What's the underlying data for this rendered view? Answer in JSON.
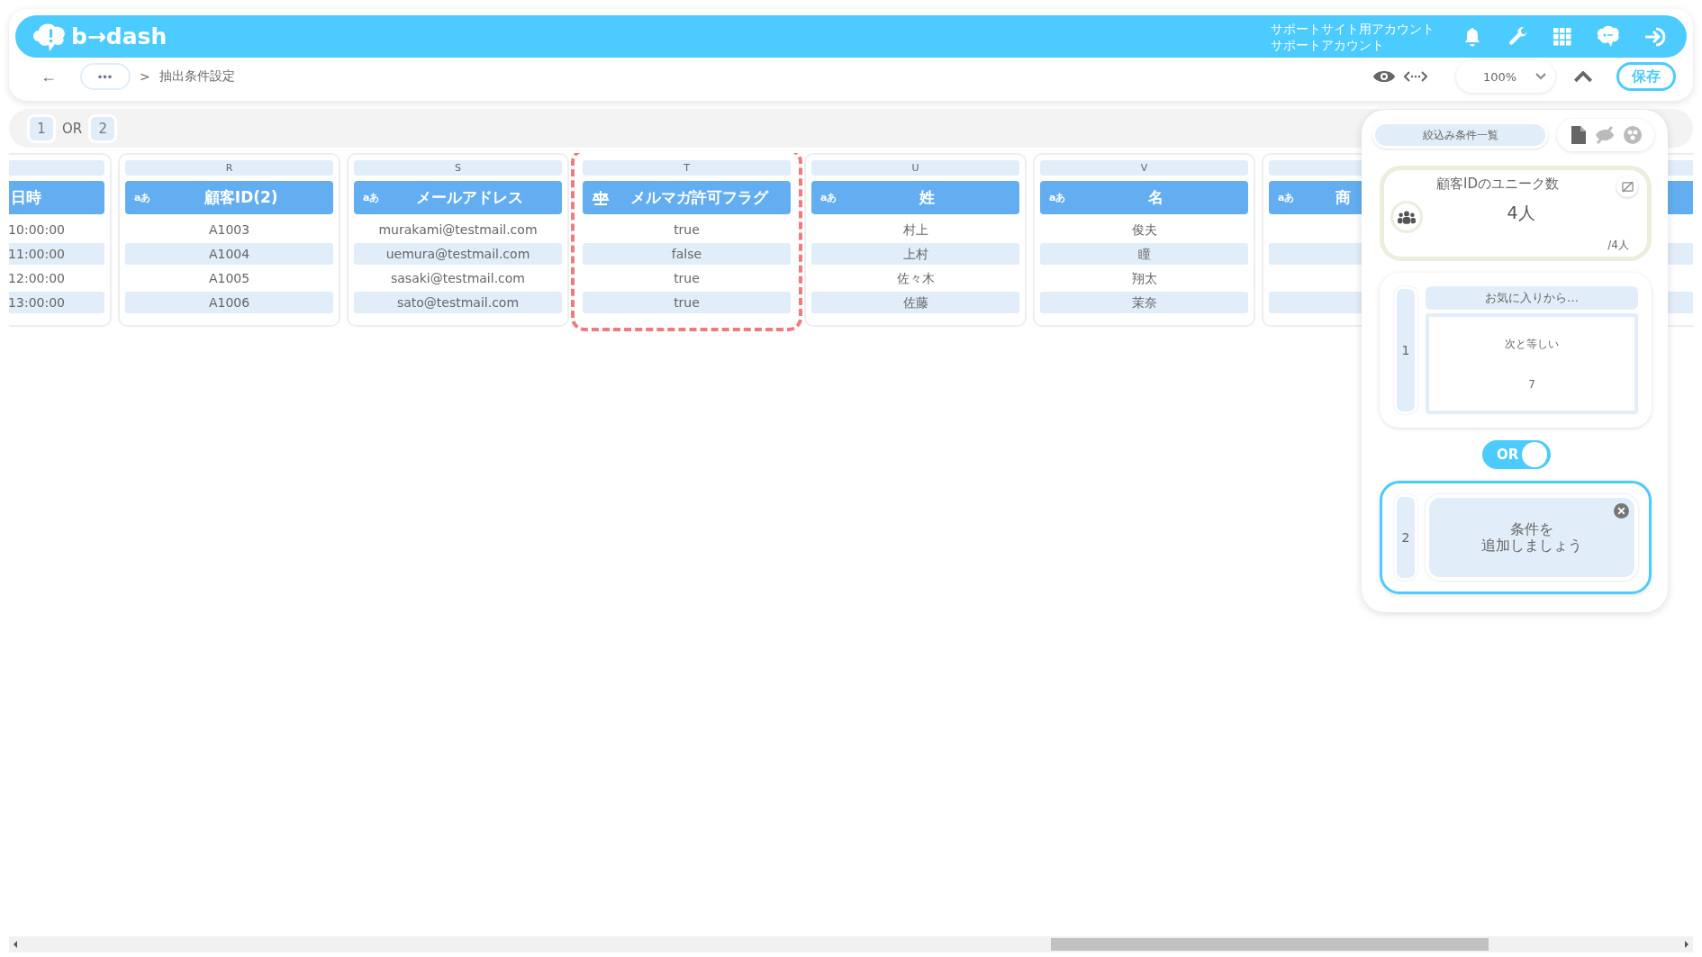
{
  "header": {
    "logo": "b→dash",
    "account_lines": [
      "サポートサイト用アカウント",
      "サポートアカウント"
    ]
  },
  "nav": {
    "back": "←",
    "more": "•••",
    "separator": ">",
    "breadcrumb": "抽出条件設定",
    "zoom": "100%",
    "save": "保存"
  },
  "groups": {
    "items": [
      "1",
      "2"
    ],
    "joiner": "OR"
  },
  "columns": [
    {
      "kind": "clipped_left",
      "title": "日時",
      "cells": [
        "10:00:00",
        "11:00:00",
        "12:00:00",
        "13:00:00"
      ]
    },
    {
      "kind": "text",
      "letter": "R",
      "type_label": "aあ",
      "title": "顧客ID(2)",
      "selected": false,
      "cells": [
        "A1003",
        "A1004",
        "A1005",
        "A1006"
      ]
    },
    {
      "kind": "text",
      "letter": "S",
      "type_label": "aあ",
      "title": "メールアドレス",
      "selected": false,
      "cells": [
        "murakami@testmail.com",
        "uemura@testmail.com",
        "sasaki@testmail.com",
        "sato@testmail.com"
      ]
    },
    {
      "kind": "boolean",
      "letter": "T",
      "title": "メルマガ許可フラグ",
      "selected": true,
      "cells": [
        "true",
        "false",
        "true",
        "true"
      ]
    },
    {
      "kind": "text",
      "letter": "U",
      "type_label": "aあ",
      "title": "姓",
      "selected": false,
      "cells": [
        "村上",
        "上村",
        "佐々木",
        "佐藤"
      ]
    },
    {
      "kind": "text",
      "letter": "V",
      "type_label": "aあ",
      "title": "名",
      "selected": false,
      "cells": [
        "俊夫",
        "瞳",
        "翔太",
        "茉奈"
      ]
    },
    {
      "kind": "clipped_right",
      "type_label": "aあ",
      "title": "商",
      "selected": false
    }
  ],
  "panel": {
    "tab": "絞込み条件一覧",
    "metric": {
      "title": "顧客IDのユニーク数",
      "value": "4人",
      "total": "/4人"
    },
    "conditions": [
      {
        "kind": "filled",
        "number": "1",
        "header": "お気に入りから…",
        "operator": "次と等しい",
        "value": "7",
        "selected": false
      },
      {
        "kind": "empty",
        "number": "2",
        "prompt_lines": [
          "条件を",
          "追加しましょう"
        ],
        "selected": true
      }
    ],
    "connector": {
      "label": "OR",
      "on": true
    }
  }
}
